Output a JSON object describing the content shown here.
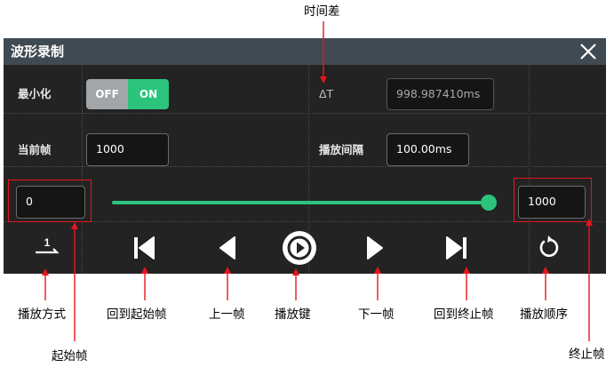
{
  "annotations": {
    "time_diff": "时间差",
    "play_mode": "播放方式",
    "start_frame": "起始帧",
    "back_to_start": "回到起始帧",
    "prev_frame": "上一帧",
    "play_key": "播放键",
    "next_frame": "下一帧",
    "back_to_end": "回到终止帧",
    "play_order": "播放顺序",
    "end_frame": "终止帧"
  },
  "window": {
    "title": "波形录制",
    "close_icon": "close-icon"
  },
  "minimize": {
    "label": "最小化",
    "off_label": "OFF",
    "on_label": "ON",
    "state": "ON"
  },
  "delta_t": {
    "label": "ΔT",
    "value": "998.987410ms"
  },
  "current_frame": {
    "label": "当前帧",
    "value": "1000"
  },
  "play_interval": {
    "label": "播放间隔",
    "value": "100.00ms"
  },
  "range": {
    "start_value": "0",
    "end_value": "1000",
    "slider_position_fraction": 1.0
  },
  "controls": {
    "play_mode_icon": "play-mode-icon",
    "play_mode_number": "1",
    "back_to_start_icon": "skip-to-start-icon",
    "prev_icon": "prev-frame-icon",
    "play_icon": "play-icon",
    "next_icon": "next-frame-icon",
    "back_to_end_icon": "skip-to-end-icon",
    "play_order_icon": "repeat-icon"
  },
  "colors": {
    "accent": "#2cc47c",
    "annotation_red": "#e8141e",
    "titlebar": "#3f4a52"
  }
}
